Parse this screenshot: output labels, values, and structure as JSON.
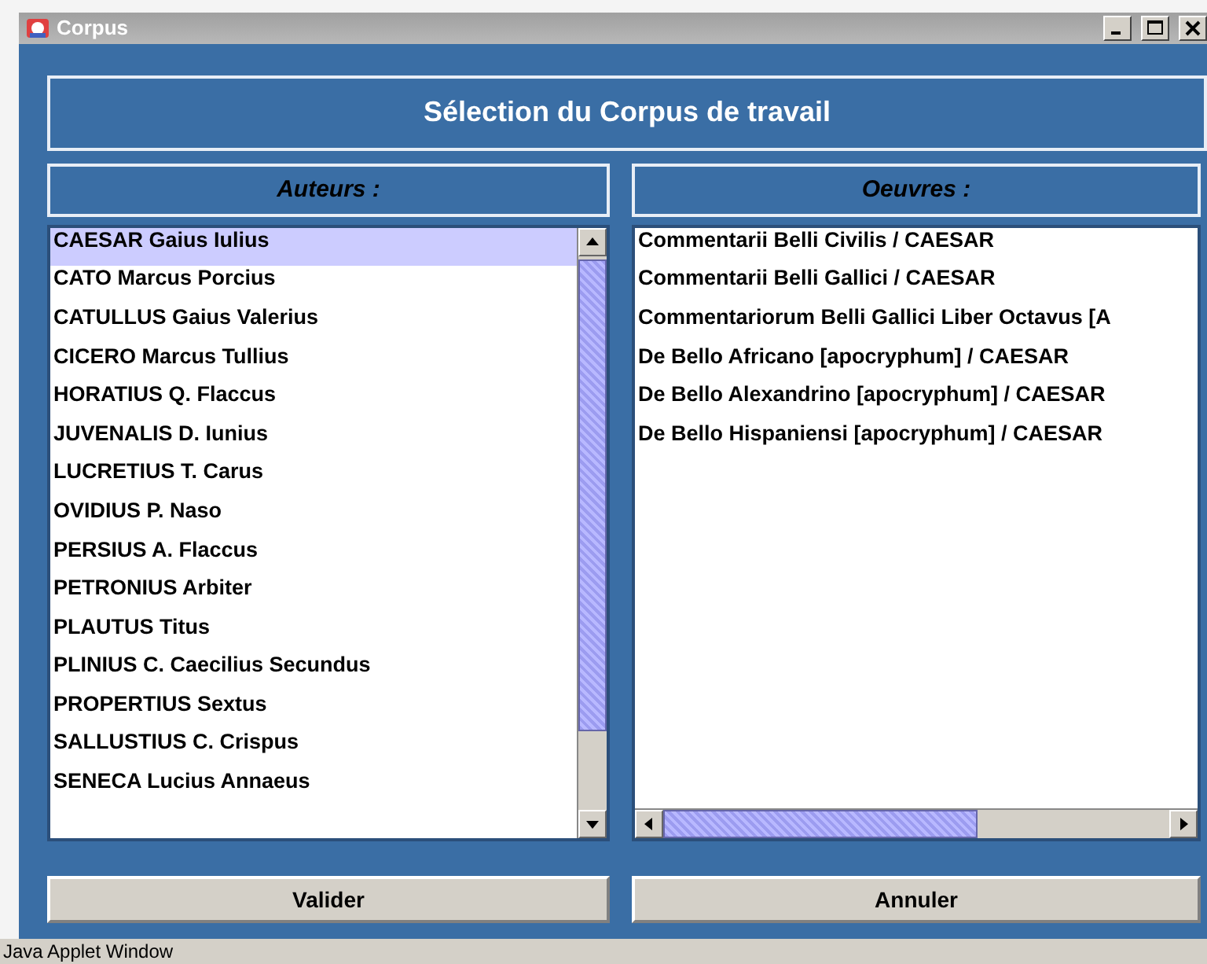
{
  "window": {
    "title": "Corpus"
  },
  "heading": "Sélection du Corpus de travail",
  "authors": {
    "label": "Auteurs :",
    "items": [
      {
        "text": "CAESAR Gaius Iulius",
        "selected": true
      },
      {
        "text": "CATO Marcus Porcius",
        "selected": false
      },
      {
        "text": "CATULLUS Gaius Valerius",
        "selected": false
      },
      {
        "text": "CICERO Marcus Tullius",
        "selected": false
      },
      {
        "text": "HORATIUS Q. Flaccus",
        "selected": false
      },
      {
        "text": "JUVENALIS D. Iunius",
        "selected": false
      },
      {
        "text": "LUCRETIUS T. Carus",
        "selected": false
      },
      {
        "text": "OVIDIUS P. Naso",
        "selected": false
      },
      {
        "text": "PERSIUS A. Flaccus",
        "selected": false
      },
      {
        "text": "PETRONIUS Arbiter",
        "selected": false
      },
      {
        "text": "PLAUTUS Titus",
        "selected": false
      },
      {
        "text": "PLINIUS C. Caecilius Secundus",
        "selected": false
      },
      {
        "text": "PROPERTIUS Sextus",
        "selected": false
      },
      {
        "text": "SALLUSTIUS C. Crispus",
        "selected": false
      },
      {
        "text": "SENECA Lucius Annaeus",
        "selected": false
      }
    ]
  },
  "works": {
    "label": "Oeuvres :",
    "items": [
      {
        "text": "Commentarii Belli Civilis / CAESAR",
        "selected": false
      },
      {
        "text": "Commentarii Belli Gallici / CAESAR",
        "selected": false
      },
      {
        "text": "Commentariorum Belli Gallici Liber Octavus [A",
        "selected": false
      },
      {
        "text": "De Bello Africano [apocryphum] / CAESAR",
        "selected": false
      },
      {
        "text": "De Bello Alexandrino [apocryphum] / CAESAR",
        "selected": false
      },
      {
        "text": "De Bello Hispaniensi [apocryphum] / CAESAR",
        "selected": false
      }
    ]
  },
  "buttons": [
    "Valider",
    "Annuler"
  ],
  "status_bar": "Java Applet Window"
}
